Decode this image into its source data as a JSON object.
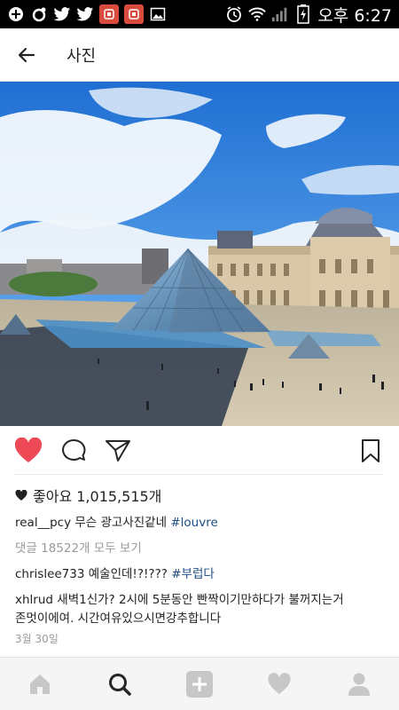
{
  "status_bar": {
    "time": "오후 6:27",
    "left_icons": [
      "add-box-icon",
      "chrome-icon",
      "twitter-icon",
      "twitter-icon",
      "app-red-icon",
      "app-red-icon",
      "gallery-icon"
    ],
    "right_icons": [
      "alarm-icon",
      "wifi-icon",
      "signal-icon",
      "battery-icon"
    ]
  },
  "header": {
    "title": "사진"
  },
  "post": {
    "likes_label": "좋아요 1,015,515개",
    "caption": {
      "user": "real__pcy",
      "text": "무슨 광고사진같네 ",
      "tag": "#louvre"
    },
    "view_comments": "댓글 18522개 모두 보기",
    "comments": [
      {
        "user": "chrislee733",
        "text": "예술인데!?!??? ",
        "tag": "#부럽다"
      },
      {
        "user": "xhlrud",
        "text": "새벽1신가?  2시에 5분동안 빤짝이기만하다가 불꺼지는거",
        "text2": "존멋이에여. 시간여유있으시면강추합니다"
      }
    ],
    "date": "3월 30일"
  },
  "colors": {
    "heart_red": "#ed4956",
    "hashtag": "#1f4f86",
    "muted": "#9a9a9a",
    "sky": "#3a7fd6"
  },
  "bottom_nav": [
    "home-icon",
    "search-icon",
    "add-icon",
    "heart-icon",
    "profile-icon"
  ]
}
